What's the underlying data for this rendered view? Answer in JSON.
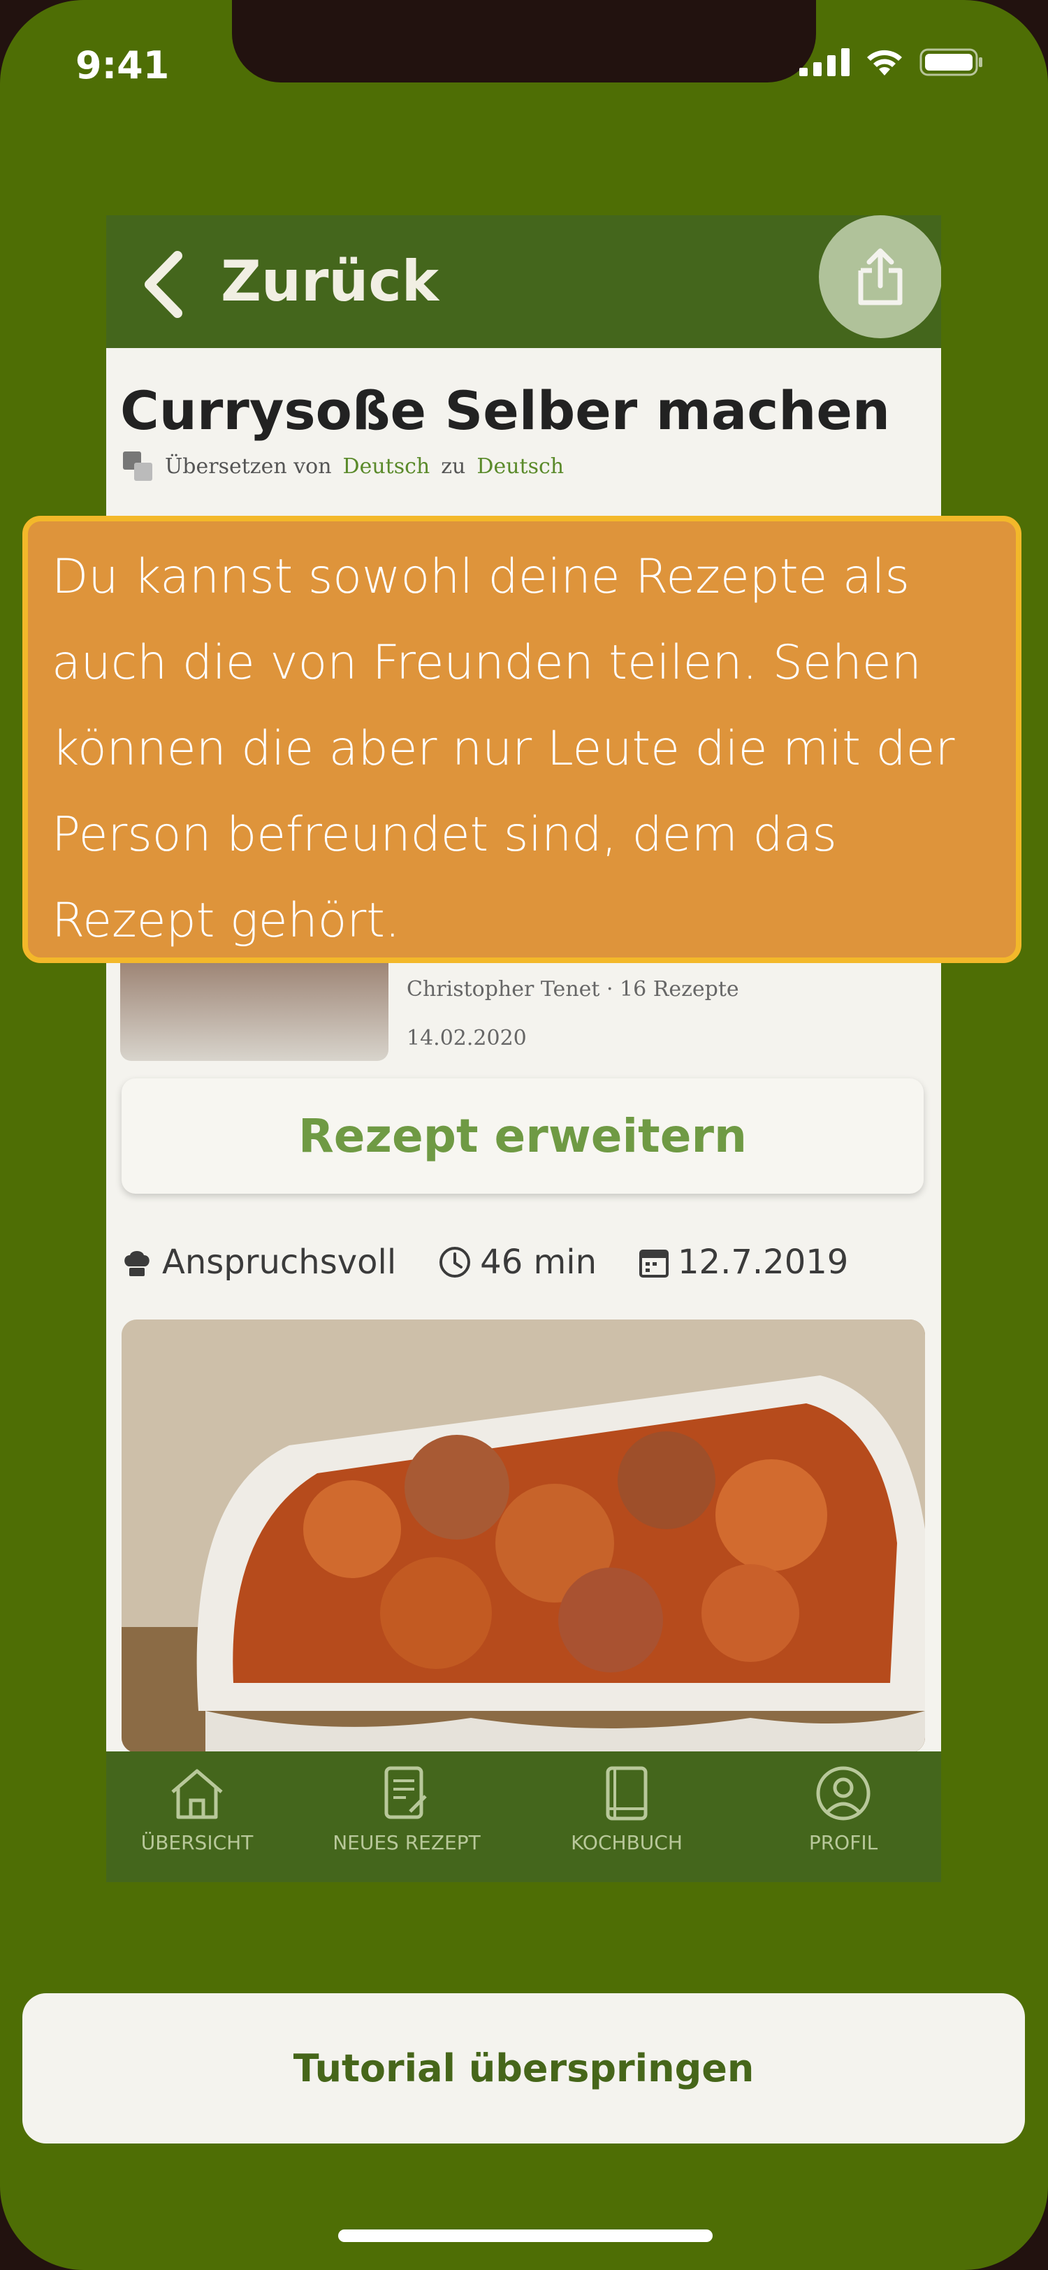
{
  "status_bar": {
    "time": "9:41"
  },
  "app": {
    "header": {
      "back_label": "Zurück"
    },
    "recipe": {
      "title": "Currysoße Selber machen",
      "translation": {
        "prefix": "Übersetzen von",
        "from": "Deutsch",
        "joiner": "zu",
        "to": "Deutsch"
      },
      "author": "Christopher Tenet · 16 Rezepte",
      "date": "14.02.2020",
      "extend_label": "Rezept erweitern",
      "difficulty": "Anspruchsvoll",
      "duration": "46 min",
      "created": "12.7.2019"
    },
    "tabbar": [
      {
        "label": "ÜBERSICHT",
        "icon": "home-icon"
      },
      {
        "label": "NEUES REZEPT",
        "icon": "new-recipe-icon"
      },
      {
        "label": "KOCHBUCH",
        "icon": "cookbook-icon"
      },
      {
        "label": "PROFIL",
        "icon": "profile-icon"
      }
    ]
  },
  "tutorial": {
    "text": "Du kannst sowohl deine Rezepte als auch die von Freunden teilen. Sehen können die aber nur Leute die mit der Person befreundet sind, dem das Rezept gehört.",
    "skip_label": "Tutorial überspringen"
  },
  "colors": {
    "background": "#4e6e05",
    "header": "#44661c",
    "tooltip": "#de943b",
    "tooltip_border": "#f3b82a",
    "accent_text": "#6f9a44"
  }
}
